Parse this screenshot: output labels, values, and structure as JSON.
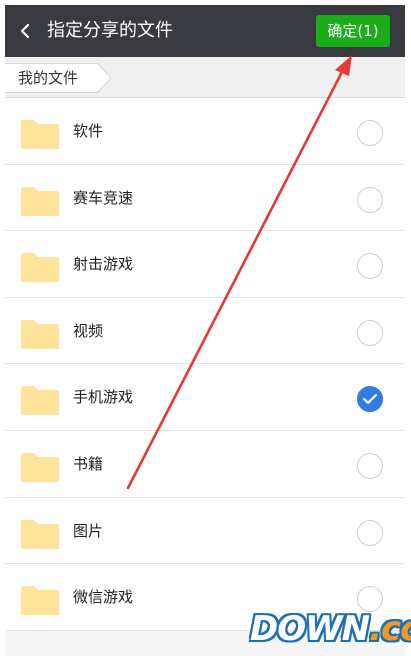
{
  "header": {
    "back_icon": "chevron-left-icon",
    "title": "指定分享的文件",
    "confirm_label": "确定(1)",
    "background_color": "#393a3f",
    "confirm_color": "#1aad19"
  },
  "breadcrumb": {
    "items": [
      {
        "label": "我的文件"
      }
    ]
  },
  "folders": [
    {
      "name": "软件",
      "selected": false,
      "icon": "folder-icon"
    },
    {
      "name": "赛车竞速",
      "selected": false,
      "icon": "folder-icon"
    },
    {
      "name": "射击游戏",
      "selected": false,
      "icon": "folder-icon"
    },
    {
      "name": "视频",
      "selected": false,
      "icon": "folder-icon"
    },
    {
      "name": "手机游戏",
      "selected": true,
      "icon": "folder-icon"
    },
    {
      "name": "书籍",
      "selected": false,
      "icon": "folder-icon"
    },
    {
      "name": "图片",
      "selected": false,
      "icon": "folder-icon"
    },
    {
      "name": "微信游戏",
      "selected": false,
      "icon": "folder-icon"
    }
  ],
  "colors": {
    "folder": "#fde49a",
    "check": "#2f7de1",
    "annotation_arrow": "#e53935"
  },
  "watermark": {
    "text_main": "DOWN",
    "text_dot": ".",
    "text_tld": "cc"
  }
}
